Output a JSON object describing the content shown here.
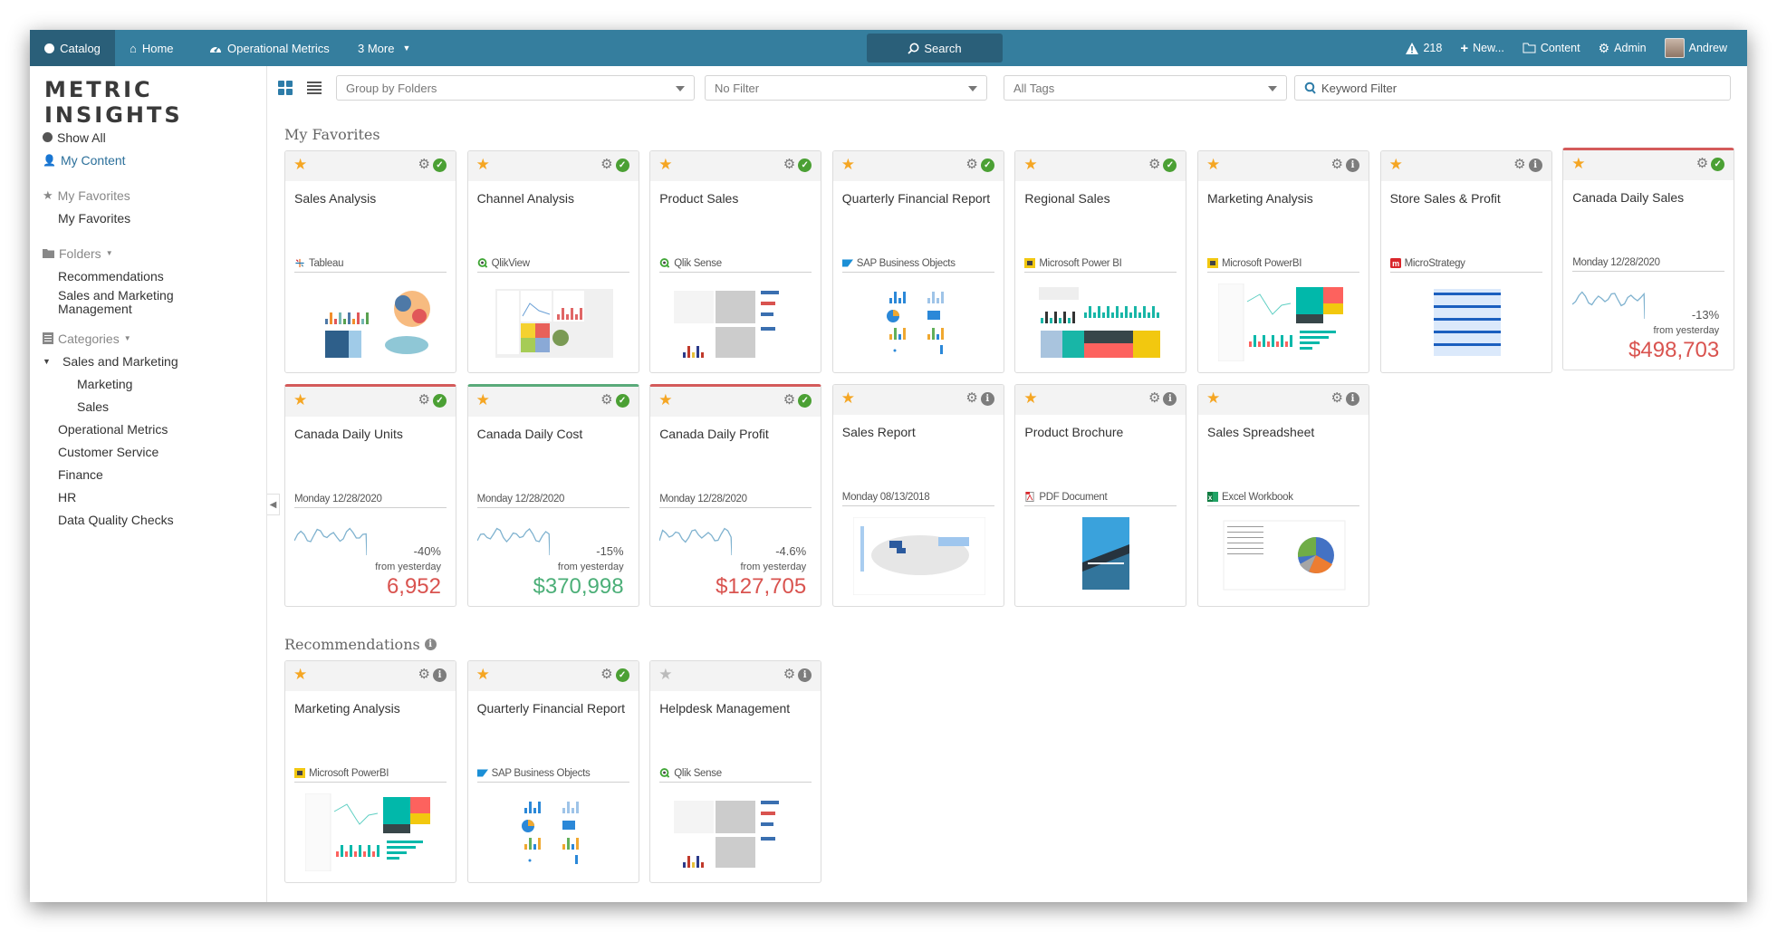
{
  "topnav": {
    "tabs": [
      {
        "label": "Catalog",
        "icon": "circle-icon",
        "active": true
      },
      {
        "label": "Home",
        "icon": "home-icon"
      },
      {
        "label": "Operational Metrics",
        "icon": "dashboard-icon"
      },
      {
        "label": "3 More",
        "icon": "caret-down-icon"
      }
    ],
    "search_label": "Search",
    "alerts_count": "218",
    "new_label": "New...",
    "content_label": "Content",
    "admin_label": "Admin",
    "user_name": "Andrew"
  },
  "sidebar": {
    "logo": "METRIC INSIGHTS",
    "show_all": "Show All",
    "my_content": "My Content",
    "favorites_header": "My Favorites",
    "favorites_items": [
      "My Favorites"
    ],
    "folders_header": "Folders",
    "folders_items": [
      "Recommendations",
      "Sales and Marketing Management"
    ],
    "categories_header": "Categories",
    "categories": {
      "expanded": "Sales and Marketing",
      "children": [
        "Marketing",
        "Sales"
      ],
      "others": [
        "Operational Metrics",
        "Customer Service",
        "Finance",
        "HR",
        "Data Quality Checks"
      ]
    }
  },
  "filters": {
    "group_by": "Group by Folders",
    "filter": "No Filter",
    "tags": "All Tags",
    "keyword_placeholder": "Keyword Filter"
  },
  "colors": {
    "nav": "#357e9e",
    "nav_active": "#2a5f79",
    "star": "#f5a623",
    "ok": "#4ba034",
    "negative": "#d9534f",
    "positive": "#4caf78"
  },
  "sections": {
    "favorites_title": "My Favorites",
    "recommendations_title": "Recommendations"
  },
  "favorites": [
    {
      "title": "Sales Analysis",
      "source": "Tableau",
      "status": "ok",
      "starred": true
    },
    {
      "title": "Channel Analysis",
      "source": "QlikView",
      "status": "ok",
      "starred": true
    },
    {
      "title": "Product Sales",
      "source": "Qlik Sense",
      "status": "ok",
      "starred": true
    },
    {
      "title": "Quarterly Financial Report",
      "source": "SAP Business Objects",
      "status": "ok",
      "starred": true
    },
    {
      "title": "Regional Sales",
      "source": "Microsoft Power BI",
      "status": "ok",
      "starred": true
    },
    {
      "title": "Marketing Analysis",
      "source": "Microsoft PowerBI",
      "status": "info",
      "starred": true
    },
    {
      "title": "Store Sales & Profit",
      "source": "MicroStrategy",
      "status": "info",
      "starred": true
    },
    {
      "title": "Canada Daily Sales",
      "date": "Monday 12/28/2020",
      "status": "ok",
      "starred": true,
      "change": "-13%",
      "change_label": "from yesterday",
      "value": "$498,703",
      "trend": "negative"
    },
    {
      "title": "Canada Daily Units",
      "date": "Monday 12/28/2020",
      "status": "ok",
      "starred": true,
      "change": "-40%",
      "change_label": "from yesterday",
      "value": "6,952",
      "trend": "negative"
    },
    {
      "title": "Canada Daily Cost",
      "date": "Monday 12/28/2020",
      "status": "ok",
      "starred": true,
      "change": "-15%",
      "change_label": "from yesterday",
      "value": "$370,998",
      "trend": "positive"
    },
    {
      "title": "Canada Daily Profit",
      "date": "Monday 12/28/2020",
      "status": "ok",
      "starred": true,
      "change": "-4.6%",
      "change_label": "from yesterday",
      "value": "$127,705",
      "trend": "negative"
    },
    {
      "title": "Sales Report",
      "source": "Monday 08/13/2018",
      "status": "info",
      "starred": true
    },
    {
      "title": "Product Brochure",
      "source": "PDF Document",
      "status": "info",
      "starred": true
    },
    {
      "title": "Sales Spreadsheet",
      "source": "Excel Workbook",
      "status": "info",
      "starred": true
    }
  ],
  "recommendations": [
    {
      "title": "Marketing Analysis",
      "source": "Microsoft PowerBI",
      "status": "info",
      "starred": true
    },
    {
      "title": "Quarterly Financial Report",
      "source": "SAP Business Objects",
      "status": "ok",
      "starred": true
    },
    {
      "title": "Helpdesk Management",
      "source": "Qlik Sense",
      "status": "info",
      "starred": false
    }
  ]
}
